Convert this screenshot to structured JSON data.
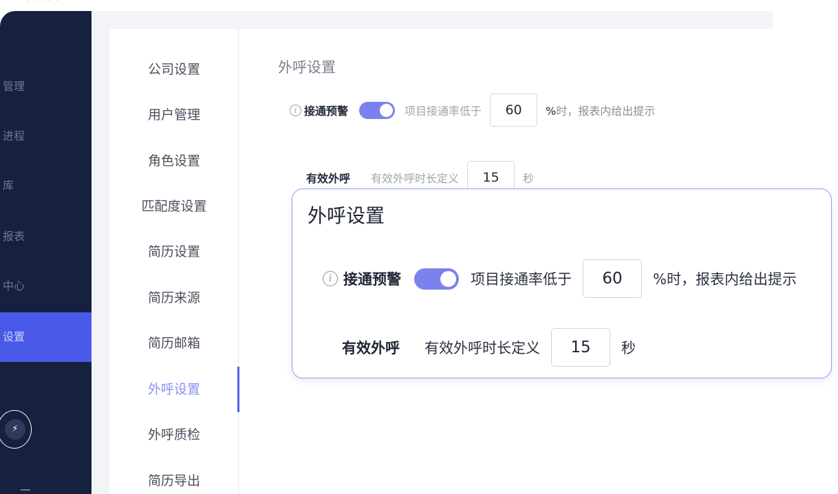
{
  "sidebar": {
    "items": [
      {
        "label": "管理"
      },
      {
        "label": "进程"
      },
      {
        "label": "库"
      },
      {
        "label": "报表"
      },
      {
        "label": "中心"
      },
      {
        "label": "设置"
      }
    ]
  },
  "settings_nav": {
    "items": [
      {
        "label": "公司设置"
      },
      {
        "label": "用户管理"
      },
      {
        "label": "角色设置"
      },
      {
        "label": "匹配度设置"
      },
      {
        "label": "简历设置"
      },
      {
        "label": "简历来源"
      },
      {
        "label": "简历邮箱"
      },
      {
        "label": "外呼设置"
      },
      {
        "label": "外呼质检"
      },
      {
        "label": "简历导出"
      }
    ],
    "active": "外呼设置"
  },
  "main": {
    "title": "外呼设置",
    "alert": {
      "label": "接通预警",
      "enabled": true,
      "prefix": "项目接通率低于",
      "value": "60",
      "suffix_pct": "%",
      "suffix_text": "时，报表内给出提示"
    },
    "effective_call": {
      "label": "有效外呼",
      "prefix": "有效外呼时长定义",
      "value": "15",
      "unit": "秒"
    }
  },
  "zoom": {
    "title": "外呼设置",
    "alert_label": "接通预警",
    "alert_prefix": "项目接通率低于",
    "alert_value": "60",
    "alert_suffix": "%时，报表内给出提示",
    "effective_label": "有效外呼",
    "effective_prefix": "有效外呼时长定义",
    "effective_value": "15",
    "effective_unit": "秒"
  },
  "colors": {
    "sidebar_bg": "#15213f",
    "accent": "#4a5ae8",
    "toggle_on": "#7b82ee",
    "zoom_border": "#8e9cf5"
  }
}
